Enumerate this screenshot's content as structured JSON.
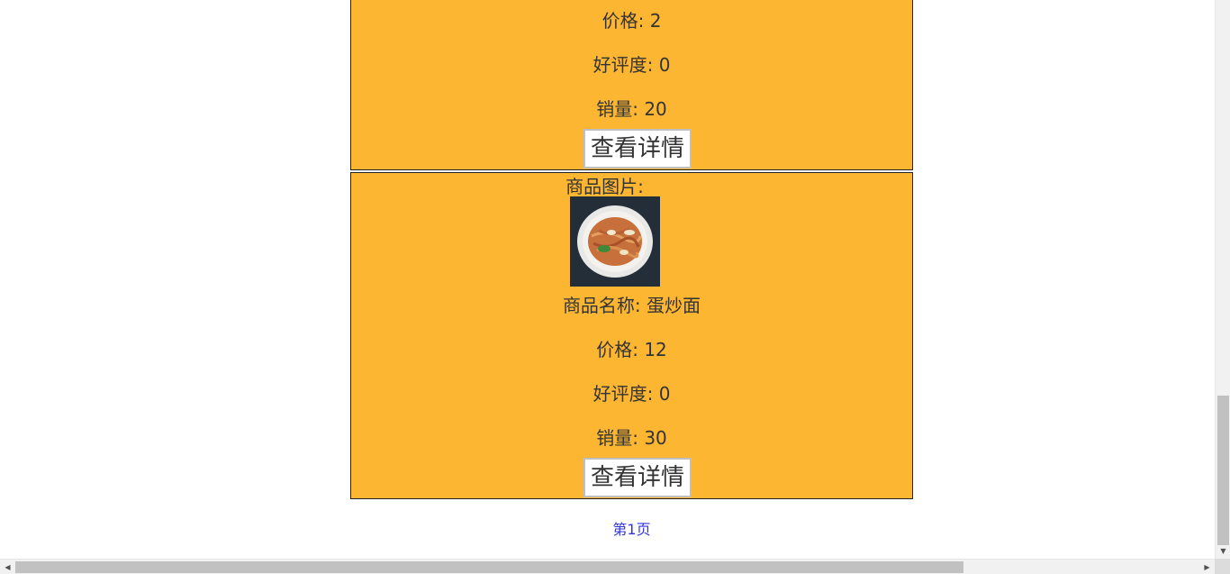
{
  "products": [
    {
      "price_label": "价格:",
      "price": "2",
      "rating_label": "好评度:",
      "rating": "0",
      "sales_label": "销量:",
      "sales": "20",
      "details_button": "查看详情"
    },
    {
      "image_label": "商品图片:",
      "image_icon": "fried-noodles-photo",
      "name_label": "商品名称:",
      "name": "蛋炒面",
      "price_label": "价格:",
      "price": "12",
      "rating_label": "好评度:",
      "rating": "0",
      "sales_label": "销量:",
      "sales": "30",
      "details_button": "查看详情"
    }
  ],
  "pagination": {
    "current_page": "第1页"
  },
  "colors": {
    "card_background": "#fdb632",
    "link": "#3333dd"
  }
}
